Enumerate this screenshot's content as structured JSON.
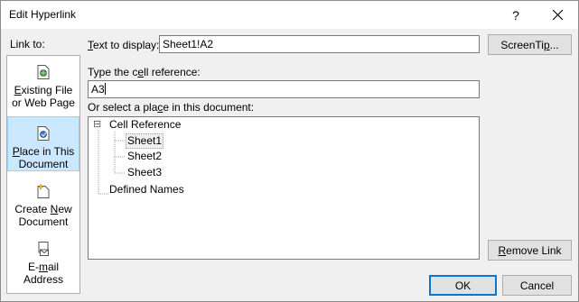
{
  "window": {
    "title": "Edit Hyperlink",
    "help_label": "?"
  },
  "link_to": {
    "label": "Link to:",
    "items": [
      {
        "label_line1": "Existing File",
        "label_line2": "or Web Page",
        "icon": "document-globe-icon"
      },
      {
        "label_line1": "Place in This",
        "label_line2": "Document",
        "icon": "document-place-icon",
        "selected": true
      },
      {
        "label_line1": "Create New",
        "label_line2": "Document",
        "icon": "new-document-icon"
      },
      {
        "label_line1": "E-mail",
        "label_line2": "Address",
        "icon": "email-icon"
      }
    ]
  },
  "text_to_display": {
    "label": "Text to display:",
    "value": "Sheet1!A2"
  },
  "screentip_label": "ScreenTip...",
  "cell_reference": {
    "label": "Type the cell reference:",
    "value": "A3"
  },
  "place_select": {
    "label": "Or select a place in this document:",
    "tree": {
      "expander": "⊟",
      "root": "Cell Reference",
      "children": [
        "Sheet1",
        "Sheet2",
        "Sheet3"
      ],
      "other": "Defined Names"
    }
  },
  "buttons": {
    "remove_link": "Remove Link",
    "ok": "OK",
    "cancel": "Cancel"
  }
}
